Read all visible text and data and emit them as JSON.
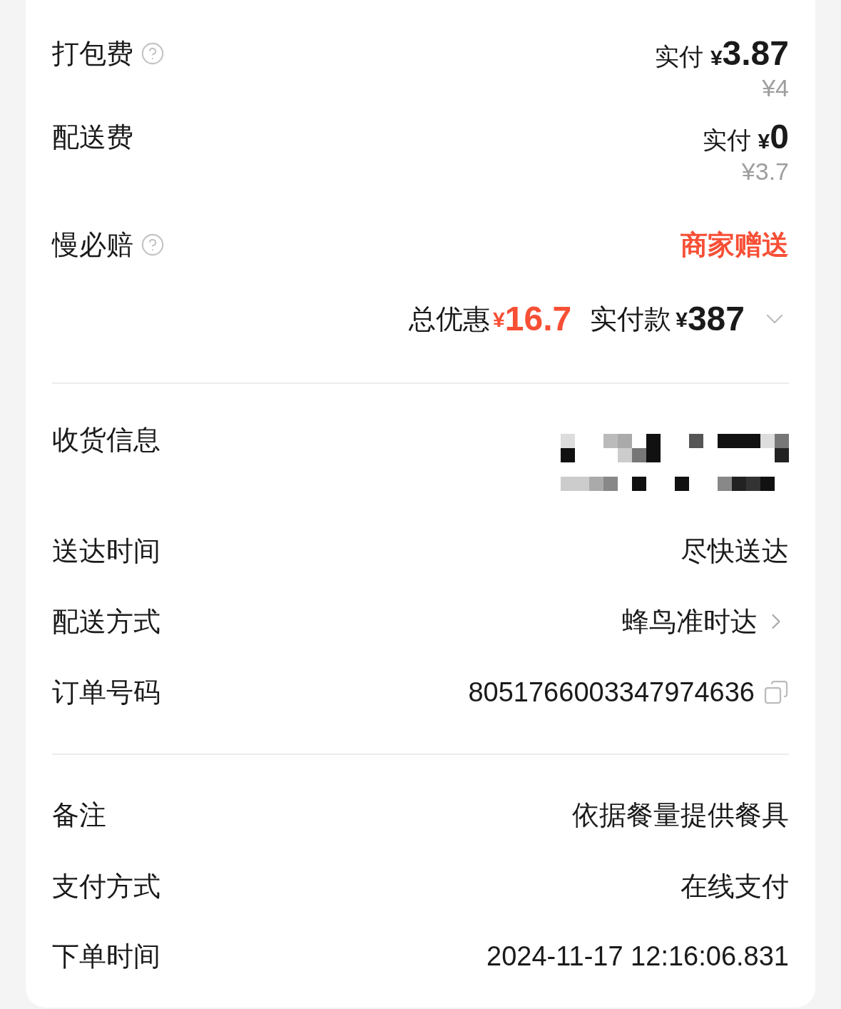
{
  "charges": [
    {
      "kind": "fee",
      "label": "打包费",
      "help": true,
      "paid_label": "实付",
      "currency": "¥",
      "amount": "3.87",
      "original": "¥4"
    },
    {
      "kind": "fee",
      "label": "配送费",
      "help": false,
      "paid_label": "实付",
      "currency": "¥",
      "amount": "0",
      "original": "¥3.7"
    },
    {
      "kind": "gift",
      "label": "慢必赔",
      "help": true,
      "value": "商家赠送"
    }
  ],
  "summary": {
    "discount_label": "总优惠",
    "discount_currency": "¥",
    "discount_amount": "16.7",
    "paid_label": "实付款",
    "paid_currency": "¥",
    "paid_amount": "387",
    "expanded": false
  },
  "delivery": [
    {
      "kind": "redacted",
      "label": "收货信息"
    },
    {
      "kind": "text",
      "label": "送达时间",
      "value": "尽快送达"
    },
    {
      "kind": "link",
      "label": "配送方式",
      "value": "蜂鸟准时达"
    },
    {
      "kind": "copy",
      "label": "订单号码",
      "value": "8051766003347974636"
    }
  ],
  "order": [
    {
      "kind": "text",
      "label": "备注",
      "value": "依据餐量提供餐具"
    },
    {
      "kind": "text",
      "label": "支付方式",
      "value": "在线支付"
    },
    {
      "kind": "text",
      "label": "下单时间",
      "value": "2024-11-17 12:16:06.831"
    }
  ]
}
